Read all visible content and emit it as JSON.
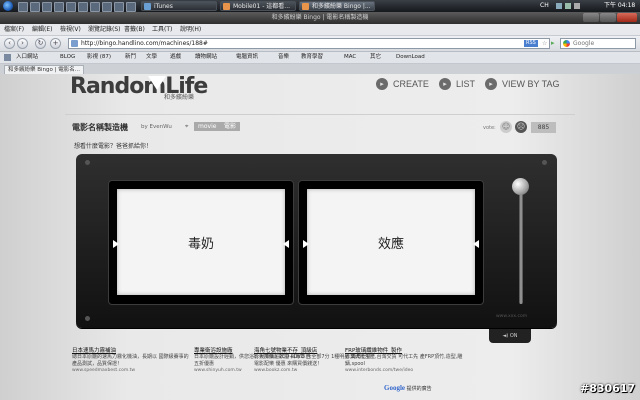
{
  "taskbar": {
    "tasks": [
      "iTunes",
      "Mobile01 - 這都看...",
      "和多繽紛樂 Bingo |..."
    ],
    "tray": {
      "lang": "CH",
      "clock": "下午 04:18"
    }
  },
  "window": {
    "title": "和多繽紛樂 Bingo | 電影名稱製造機"
  },
  "menu": {
    "items": [
      "檔案(F)",
      "編輯(E)",
      "檢視(V)",
      "瀏覽記錄(S)",
      "書籤(B)",
      "工具(T)",
      "說明(H)"
    ]
  },
  "nav": {
    "url": "http://bingo.handlino.com/machines/188#",
    "rss_label": "RSS",
    "search_placeholder": "Google"
  },
  "bookmarks": {
    "items": [
      "入口網站",
      "BLOG",
      "影視 (87)",
      "新鬥",
      "文學",
      "遊戲",
      "讀物網站",
      "電腦資訊",
      "音樂",
      "教育學習",
      "MAC",
      "其它",
      "DownLoad"
    ]
  },
  "tabs": {
    "items": [
      "和多繽紛樂 Bingo | 電影名..."
    ]
  },
  "site": {
    "logo": "RandomLife",
    "logo_sub": "和多繽紛樂",
    "nav": {
      "create": "CREATE",
      "list": "LIST",
      "view_by_tag": "VIEW BY TAG"
    }
  },
  "machine": {
    "title": "電影名稱製造機",
    "by": "by EvenWu",
    "tags": [
      "movie",
      "電影"
    ],
    "vote_label": "vote:",
    "vote_count": "885",
    "question": "想看什麼電影？爸爸抓給你！",
    "results": [
      "毒奶",
      "效應"
    ],
    "url": "www.xxx.com",
    "sound": "ON"
  },
  "ads": [
    {
      "title": "日本速馬力霧補油",
      "body": "總日本原廠的速馬力霧化機油，長期以 國際級賽事的產品測試，品質保證！",
      "url": "www.speedmaxbest.com.tw"
    },
    {
      "title": "專業衛浴設施廠",
      "body": "日本原廠設計經銷，供您浴行大降價 / 歡迎 與專本自五折優惠",
      "url": "www.shinyuh.com.tw"
    },
    {
      "title": "海角七號物業不存_頂級店",
      "body": "影視加購超2CD+DVD 含全部7分 1種明星 海角七號電影配樂 優惠 來購買價錢送！",
      "url": "www.bookz.com.tw"
    },
    {
      "title": "FRP玻璃纖維物件_製作",
      "body": "專業大陸生產,台灣交貨 可代工先 產FRP頂竹,造型,雕鑄,spool",
      "url": "www.interbonds.com/twe/ideo"
    }
  ],
  "google": {
    "brand": "Google",
    "label": "提供的廣告"
  },
  "watermark": "#830617"
}
